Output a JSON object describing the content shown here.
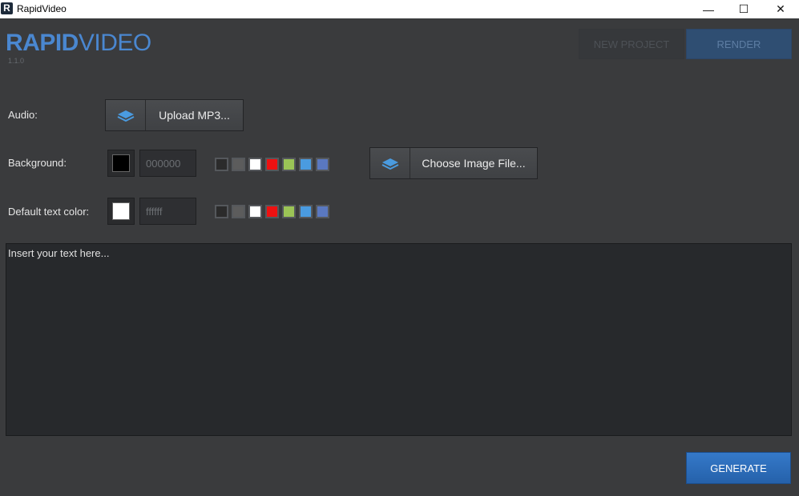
{
  "window": {
    "title": "RapidVideo",
    "app_icon_letter": "R",
    "minimize_glyph": "—",
    "maximize_glyph": "☐",
    "close_glyph": "✕"
  },
  "header": {
    "logo_part1": "RAPID",
    "logo_part2": "VIDEO",
    "version": "1.1.0",
    "new_project_label": "NEW PROJECT",
    "render_label": "RENDER"
  },
  "audio": {
    "label": "Audio:",
    "upload_label": "Upload MP3...",
    "icon": "layers-icon"
  },
  "background": {
    "label": "Background:",
    "color": "#000000",
    "hex_value": "000000",
    "choose_image_label": "Choose Image File...",
    "icon": "layers-icon"
  },
  "text_color": {
    "label": "Default text color:",
    "color": "#ffffff",
    "hex_value": "ffffff"
  },
  "palette": [
    "#2b2b2b",
    "#5c5c5c",
    "#ffffff",
    "#ee1111",
    "#9bc456",
    "#4a9be0",
    "#5a78c0"
  ],
  "editor": {
    "placeholder": "Insert your text here..."
  },
  "generate_label": "GENERATE",
  "colors": {
    "accent": "#2b6cbf",
    "logo": "#4a87d0",
    "background": "#3a3b3d"
  }
}
